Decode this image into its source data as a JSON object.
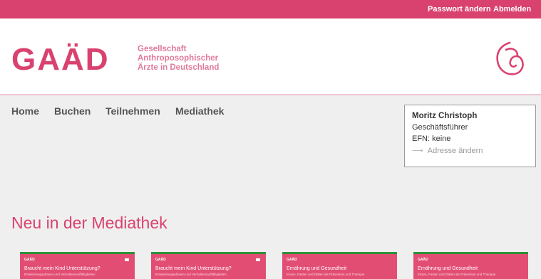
{
  "topbar": {
    "password_link": "Passwort ändern",
    "logout_link": "Abmelden"
  },
  "logo": {
    "letters": "GAÄD",
    "line1": "Gesellschaft",
    "line2": "Anthroposophischer",
    "line3": "Ärzte in Deutschland"
  },
  "icons": {
    "emblem": "gaad-emblem-icon",
    "address_arrow": "arrow-right-icon"
  },
  "nav": [
    {
      "label": "Home"
    },
    {
      "label": "Buchen"
    },
    {
      "label": "Teilnehmen"
    },
    {
      "label": "Mediathek"
    }
  ],
  "user": {
    "name": "Moritz Christoph",
    "role": "Geschäftsführer",
    "efn": "EFN: keine",
    "address_link": "Adresse ändern"
  },
  "section": {
    "title": "Neu in der Mediathek"
  },
  "cards": [
    {
      "brand": "GAÄD",
      "title": "Braucht mein Kind Unterstützung?",
      "subtitle": "Entwicklungsphasen und Verhaltensauffälligkeiten"
    },
    {
      "brand": "GAÄD",
      "title": "Braucht mein Kind Unterstützung?",
      "subtitle": "Entwicklungsphasen und Verhaltensauffälligkeiten"
    },
    {
      "brand": "GAÄD",
      "title": "Ernährung und Gesundheit",
      "subtitle": "Essen, Fasten und Diäten als Prävention und Therapie"
    },
    {
      "brand": "GAÄD",
      "title": "Ernährung und Gesundheit",
      "subtitle": "Essen, Fasten und Diäten als Prävention und Therapie"
    }
  ],
  "colors": {
    "brand_pink": "#d9426f",
    "card_pink": "#e24e73",
    "card_accent_green": "#2e8f3a"
  }
}
